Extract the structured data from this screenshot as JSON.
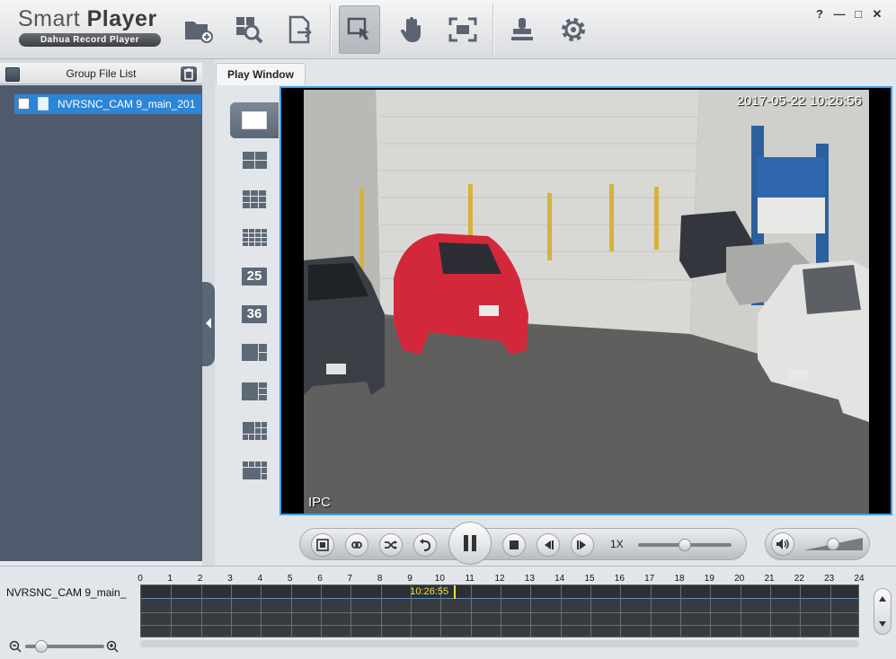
{
  "app": {
    "title_light": "Smart ",
    "title_bold": "Player",
    "subtitle": "Dahua Record Player"
  },
  "toolbar": {
    "icons": [
      "open-folder-icon",
      "search-file-icon",
      "export-icon",
      "select-cursor-icon",
      "hand-drag-icon",
      "fit-screen-icon",
      "stamp-icon",
      "settings-gear-icon"
    ],
    "active": "select-cursor-icon"
  },
  "window_controls": {
    "help": "?",
    "minimize": "—",
    "maximize": "□",
    "close": "✕"
  },
  "left_panel": {
    "title": "Group File List",
    "files": [
      {
        "name": "NVRSNC_CAM 9_main_201",
        "checked": false,
        "selected": true
      }
    ]
  },
  "tabs": {
    "play_window": "Play Window"
  },
  "split_options": [
    "1",
    "4",
    "9",
    "16",
    "25",
    "36",
    "custom-a",
    "custom-b",
    "custom-c",
    "custom-d"
  ],
  "split_numbers": {
    "n25": "25",
    "n36": "36"
  },
  "video": {
    "timestamp": "2017-05-22 10:26:56",
    "label": "IPC"
  },
  "playback": {
    "speed": "1X",
    "speed_slider": 0.5,
    "volume_slider": 0.5
  },
  "timeline": {
    "channel": "NVRSNC_CAM 9_main_",
    "hours": [
      "0",
      "1",
      "2",
      "3",
      "4",
      "5",
      "6",
      "7",
      "8",
      "9",
      "10",
      "11",
      "12",
      "13",
      "14",
      "15",
      "16",
      "17",
      "18",
      "19",
      "20",
      "21",
      "22",
      "23",
      "24"
    ],
    "current_time": "10:26:55",
    "zoom_level": 0.2
  },
  "colors": {
    "accent_blue": "#2c86d8",
    "frame_border": "#3aa0e8",
    "cursor_yellow": "#f2e04a",
    "panel_dark": "#4f5b6c"
  }
}
